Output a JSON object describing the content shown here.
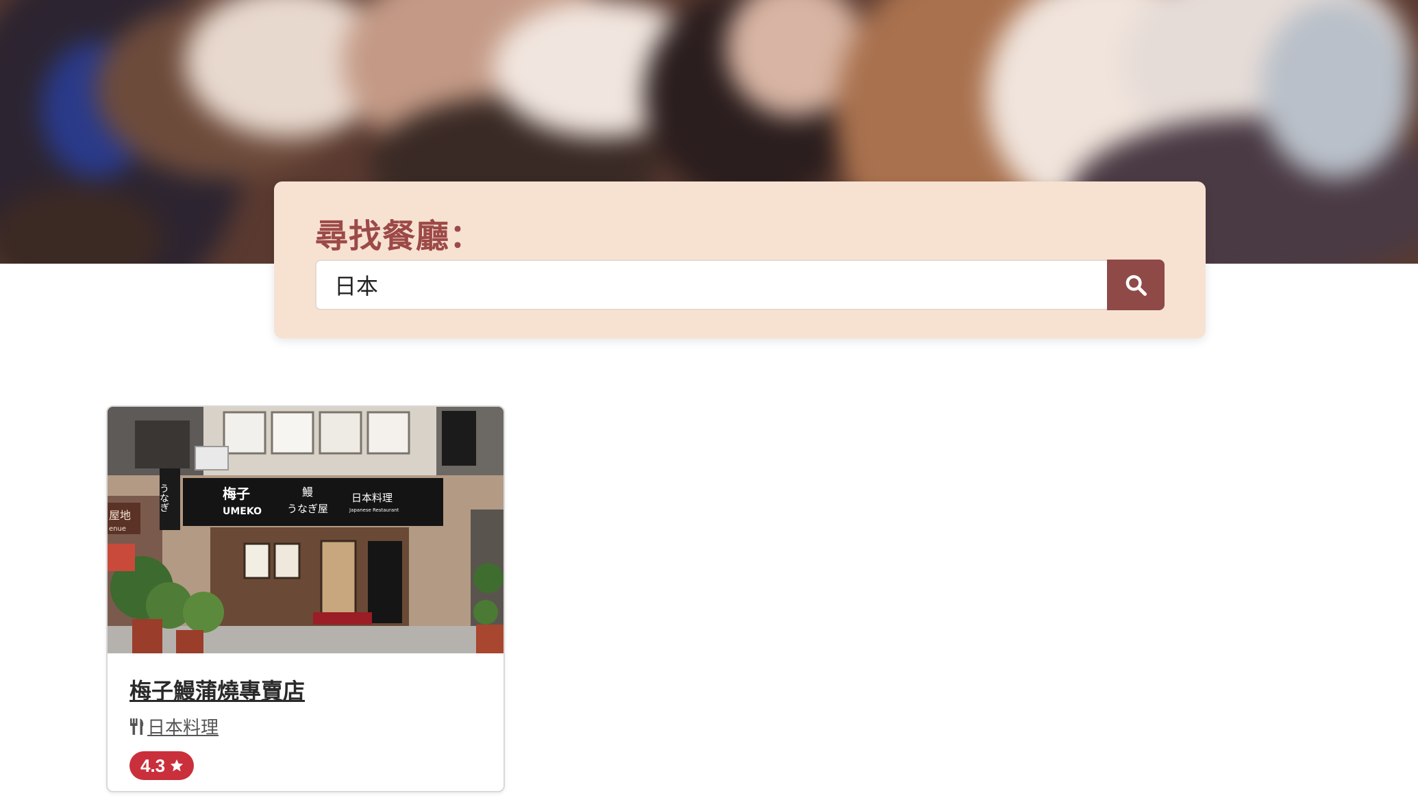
{
  "search": {
    "title": "尋找餐廳：",
    "value": "日本",
    "button_icon": "search-icon"
  },
  "restaurants": [
    {
      "name": "梅子鰻蒲燒專賣店",
      "category_icon": "utensils-icon",
      "category": "日本料理",
      "rating": "4.3",
      "rating_icon": "star-icon",
      "photo_sign": {
        "brand_jp": "梅子",
        "brand_en": "UMEKO",
        "unagi": "鰻",
        "unagi_kana": "うなぎ屋",
        "restaurant_jp": "日本料理",
        "restaurant_en": "Japanese Restaurant",
        "side_sign": "うなぎ",
        "neighbor_sign": "屋地",
        "neighbor_sign_en": "enue"
      }
    }
  ],
  "colors": {
    "search_card_bg": "#f7e2d2",
    "accent": "#8f4a47",
    "title": "#9c4a48",
    "rating_badge": "#c9303b"
  }
}
